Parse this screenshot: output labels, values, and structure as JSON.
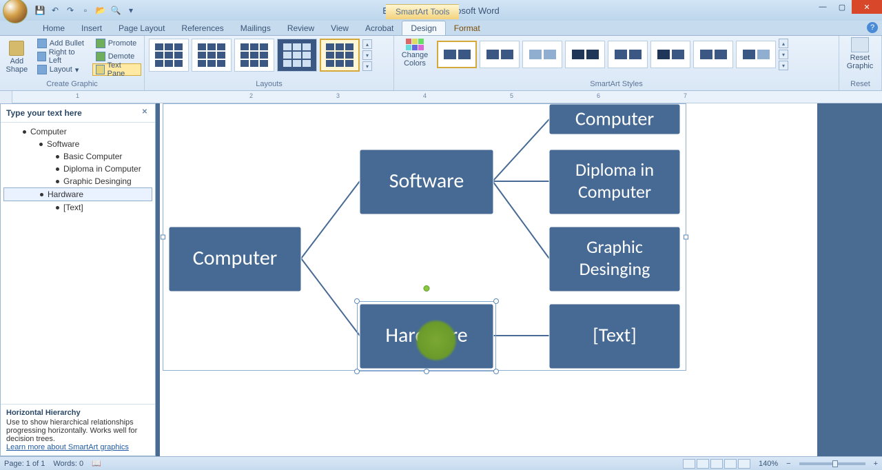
{
  "title": {
    "doc": "Bishun.docx - Microsoft Word",
    "context": "SmartArt Tools"
  },
  "tabs": [
    "Home",
    "Insert",
    "Page Layout",
    "References",
    "Mailings",
    "Review",
    "View",
    "Acrobat",
    "Design",
    "Format"
  ],
  "active_tab_index": 8,
  "ribbon": {
    "create_graphic": {
      "label": "Create Graphic",
      "add_shape": "Add\nShape",
      "layout": "Layout",
      "add_bullet": "Add Bullet",
      "right_to_left": "Right to Left",
      "promote": "Promote",
      "demote": "Demote",
      "text_pane": "Text Pane"
    },
    "layouts": {
      "label": "Layouts"
    },
    "change_colors": "Change\nColors",
    "styles": {
      "label": "SmartArt Styles"
    },
    "reset": {
      "label": "Reset",
      "btn": "Reset\nGraphic"
    }
  },
  "text_pane": {
    "header": "Type your text here",
    "items": [
      {
        "text": "Computer",
        "level": 1
      },
      {
        "text": "Software",
        "level": 2
      },
      {
        "text": "Basic Computer",
        "level": 3
      },
      {
        "text": "Diploma in Computer",
        "level": 3
      },
      {
        "text": "Graphic Desinging",
        "level": 3
      },
      {
        "text": "Hardware",
        "level": 2,
        "selected": true
      },
      {
        "text": "[Text]",
        "level": 3
      }
    ],
    "info_title": "Horizontal Hierarchy",
    "info_desc": "Use to show hierarchical relationships progressing horizontally. Works well for decision trees.",
    "info_link": "Learn more about SmartArt graphics"
  },
  "smartart": {
    "nodes": {
      "root": "Computer",
      "software": "Software",
      "hardware": "Hardware",
      "basic": "Computer",
      "diploma1": "Diploma in",
      "diploma2": "Computer",
      "graphic1": "Graphic",
      "graphic2": "Desinging",
      "placeholder": "[Text]"
    }
  },
  "status": {
    "page": "Page: 1 of 1",
    "words": "Words: 0",
    "zoom": "140%"
  },
  "ruler_numbers": [
    "1",
    "2",
    "3",
    "4",
    "5",
    "6",
    "7"
  ]
}
